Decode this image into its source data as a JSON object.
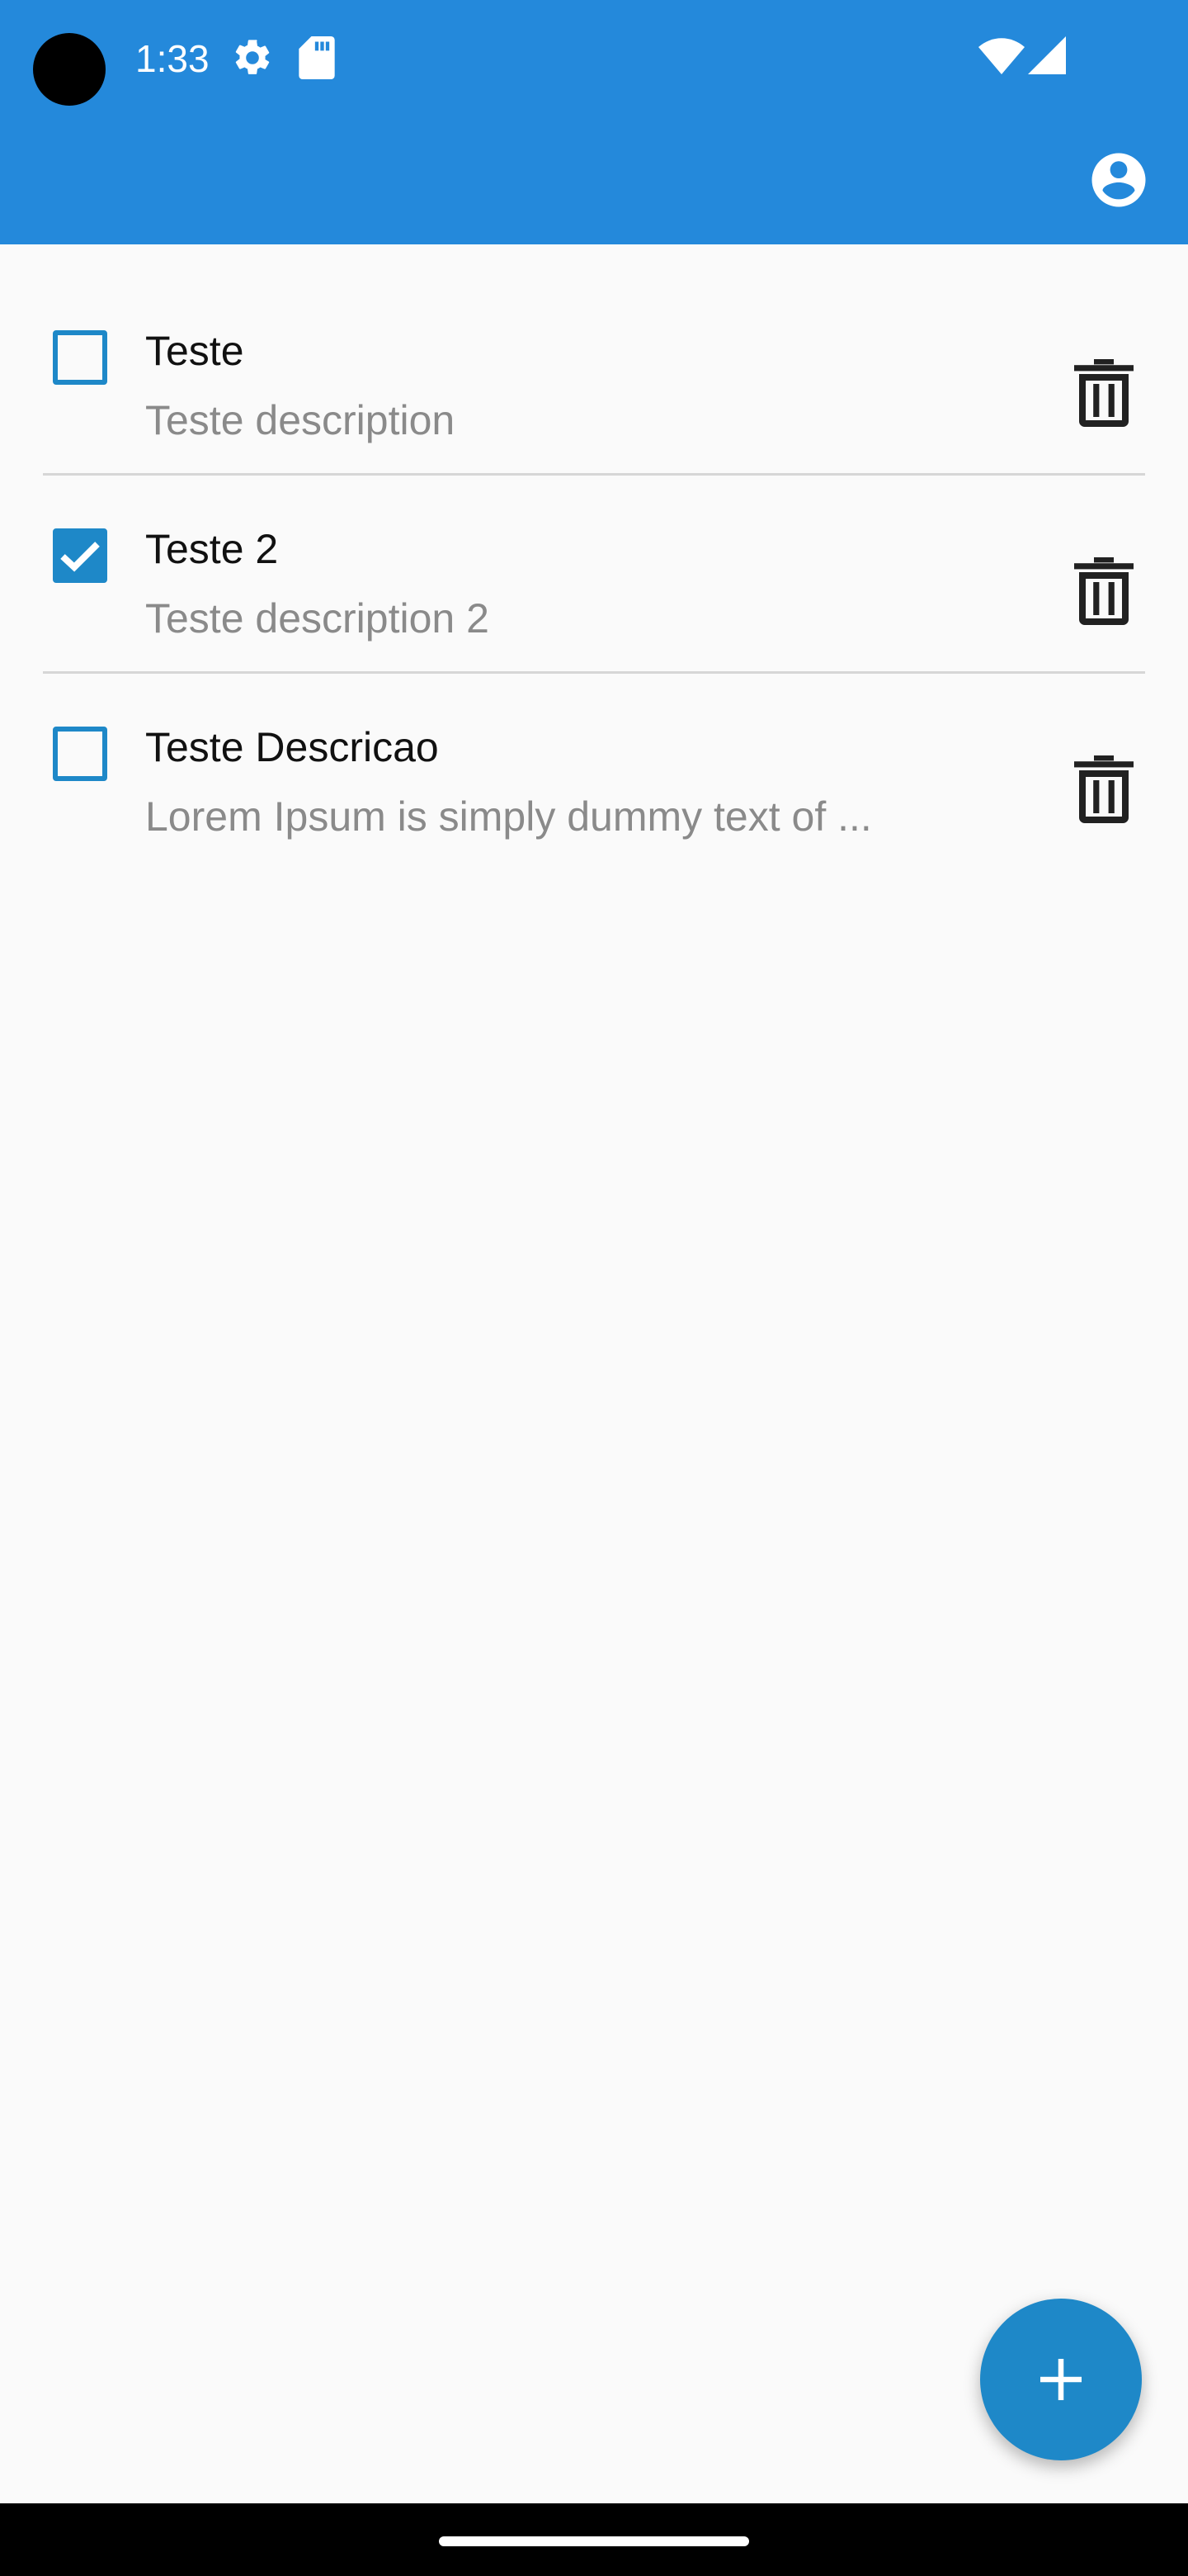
{
  "status_bar": {
    "time": "1:33",
    "icons": [
      "settings-icon",
      "sd-card-icon",
      "wifi-icon",
      "signal-icon"
    ]
  },
  "app_bar": {
    "account_icon": "account-circle-icon"
  },
  "tasks": [
    {
      "title": "Teste",
      "description": "Teste description",
      "checked": false
    },
    {
      "title": "Teste 2",
      "description": "Teste description 2",
      "checked": true
    },
    {
      "title": "Teste Descricao",
      "description": "Lorem Ipsum is simply dummy text of ...",
      "checked": false
    }
  ],
  "fab": {
    "icon": "plus-icon"
  },
  "colors": {
    "primary": "#2489db",
    "accent": "#1e88c8",
    "background": "#fafafa",
    "description_text": "#8a8a8a"
  }
}
